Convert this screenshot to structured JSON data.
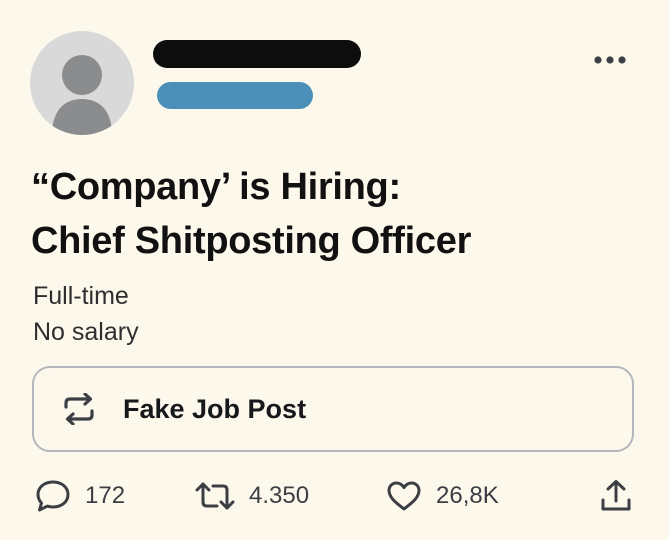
{
  "post": {
    "headline_line1": "“Company’ is Hiring:",
    "headline_line2": "Chief Shitposting Officer",
    "meta_line1": "Full-time",
    "meta_line2": "No salary",
    "quoted_label": "Fake Job Post"
  },
  "actions": {
    "replies": "172",
    "reposts": "4.350",
    "likes": "26,8K"
  },
  "colors": {
    "background": "#fdf8ec",
    "redacted_name": "#0d0d0d",
    "redacted_handle": "#4a90b8",
    "avatar_bg": "#d9d9d9",
    "avatar_figure": "#8b8c8e",
    "icon": "#3b3f44"
  },
  "icons": {
    "more": "more-horizontal-icon",
    "quoted": "repost-icon",
    "reply": "reply-bubble-icon",
    "repost": "repost-icon",
    "like": "heart-icon",
    "share": "share-upload-icon"
  }
}
